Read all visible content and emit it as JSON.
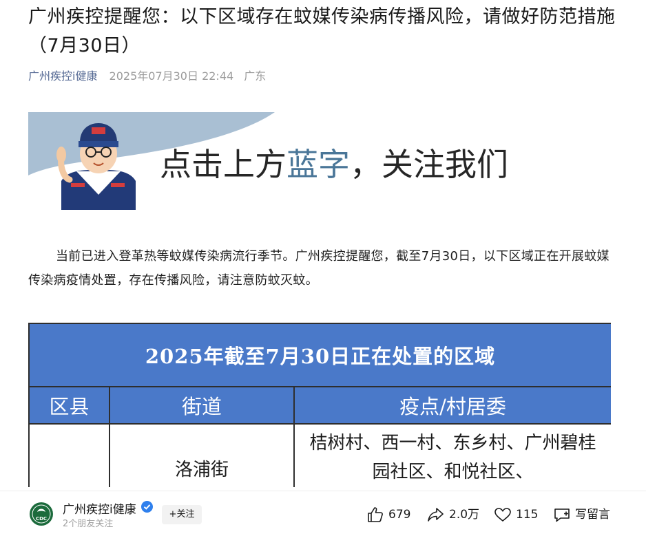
{
  "article": {
    "title": "广州疾控提醒您：以下区域存在蚊媒传染病传播风险，请做好防范措施（7月30日）",
    "author": "广州疾控i健康",
    "date": "2025年07月30日 22:44",
    "location": "广东"
  },
  "banner": {
    "text_before": "点击上方",
    "text_highlight": "蓝字",
    "text_after": "，关注我们"
  },
  "paragraph": "当前已进入登革热等蚊媒传染病流行季节。广州疾控提醒您，截至7月30日，以下区域正在开展蚊媒传染病疫情处置，存在传播风险，请注意防蚊灭蚊。",
  "table": {
    "title": "2025年截至7月30日正在处置的区域",
    "headers": [
      "区县",
      "街道",
      "疫点/村居委"
    ],
    "rows": [
      {
        "district": "",
        "street": "洛浦街",
        "spots": "桔树村、西一村、东乡村、广州碧桂园社区、和悦社区、"
      }
    ]
  },
  "bottombar": {
    "account_name": "广州疾控i健康",
    "logo_text": "CDC",
    "followers": "2个朋友关注",
    "follow_label": "+关注",
    "likes": "679",
    "shares": "2.0万",
    "favorites": "115",
    "comment_label": "写留言"
  },
  "colors": {
    "author_link": "#576b95",
    "table_header": "#4a79c9",
    "banner_highlight": "#4a7698"
  }
}
